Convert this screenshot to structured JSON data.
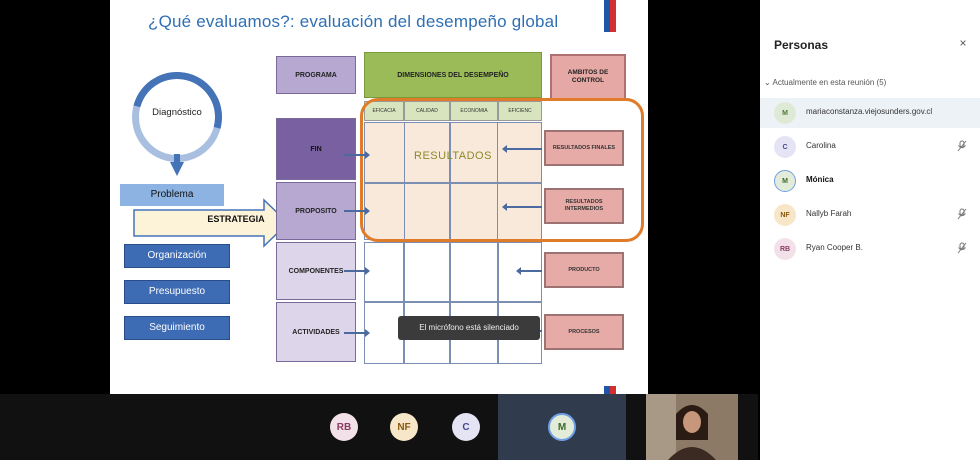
{
  "slide": {
    "title": "¿Qué evaluamos?: evaluación del desempeño global",
    "diagnostic_label": "Diagnóstico",
    "problem_label": "Problema",
    "strategy_label": "ESTRATEGIA",
    "left_boxes": [
      "Organización",
      "Presupuesto",
      "Seguimiento"
    ],
    "matrix_rows": [
      "PROGRAMA",
      "FIN",
      "PROPOSITO",
      "COMPONENTES",
      "ACTIVIDADES"
    ],
    "dimensions_header": "DIMENSIONES DEL DESEMPEÑO",
    "dimension_columns": [
      "EFICACIA",
      "CALIDAD",
      "ECONOMIA",
      "EFICIENC"
    ],
    "control_header": "AMBITOS DE CONTROL",
    "results_label": "RESULTADOS",
    "control_items": [
      "RESULTADOS FINALES",
      "RESULTADOS INTERMEDIOS",
      "PRODUCTO",
      "PROCESOS"
    ]
  },
  "toast": "El micrófono está silenciado",
  "call_bar": {
    "avatars": [
      {
        "initials": "RB",
        "bg": "#f3e1ea",
        "fg": "#8a3a62"
      },
      {
        "initials": "NF",
        "bg": "#f7e6c8",
        "fg": "#8a5a10"
      },
      {
        "initials": "C",
        "bg": "#e4e4f5",
        "fg": "#4a4a8a"
      },
      {
        "initials": "M",
        "bg": "#e2ecd8",
        "fg": "#3c6a2a"
      }
    ]
  },
  "panel": {
    "title": "Personas",
    "close_icon": "×",
    "section": "Actualmente en esta reunión (5)",
    "people": [
      {
        "initials": "M",
        "name": "mariaconstanza.viejosunders.gov.cl",
        "bg": "#dfead6",
        "fg": "#4a7a3a",
        "muted": false
      },
      {
        "initials": "C",
        "name": "Carolina",
        "bg": "#e4e4f5",
        "fg": "#4a4a8a",
        "muted": true
      },
      {
        "initials": "M",
        "name": "Mónica",
        "bg": "#e2ecd8",
        "fg": "#3c6a2a",
        "muted": false
      },
      {
        "initials": "NF",
        "name": "Nallyb Farah",
        "bg": "#f7e6c8",
        "fg": "#8a5a10",
        "muted": true
      },
      {
        "initials": "RB",
        "name": "Ryan Cooper B.",
        "bg": "#f3e1ea",
        "fg": "#8a3a62",
        "muted": true
      }
    ],
    "mic_off_icon": "🎤"
  },
  "colors": {
    "accent_blue": "#2f6fb4",
    "frame_orange": "#e07b2a",
    "dimension_green": "#9bbb59",
    "control_pink": "#e6a8a5"
  }
}
